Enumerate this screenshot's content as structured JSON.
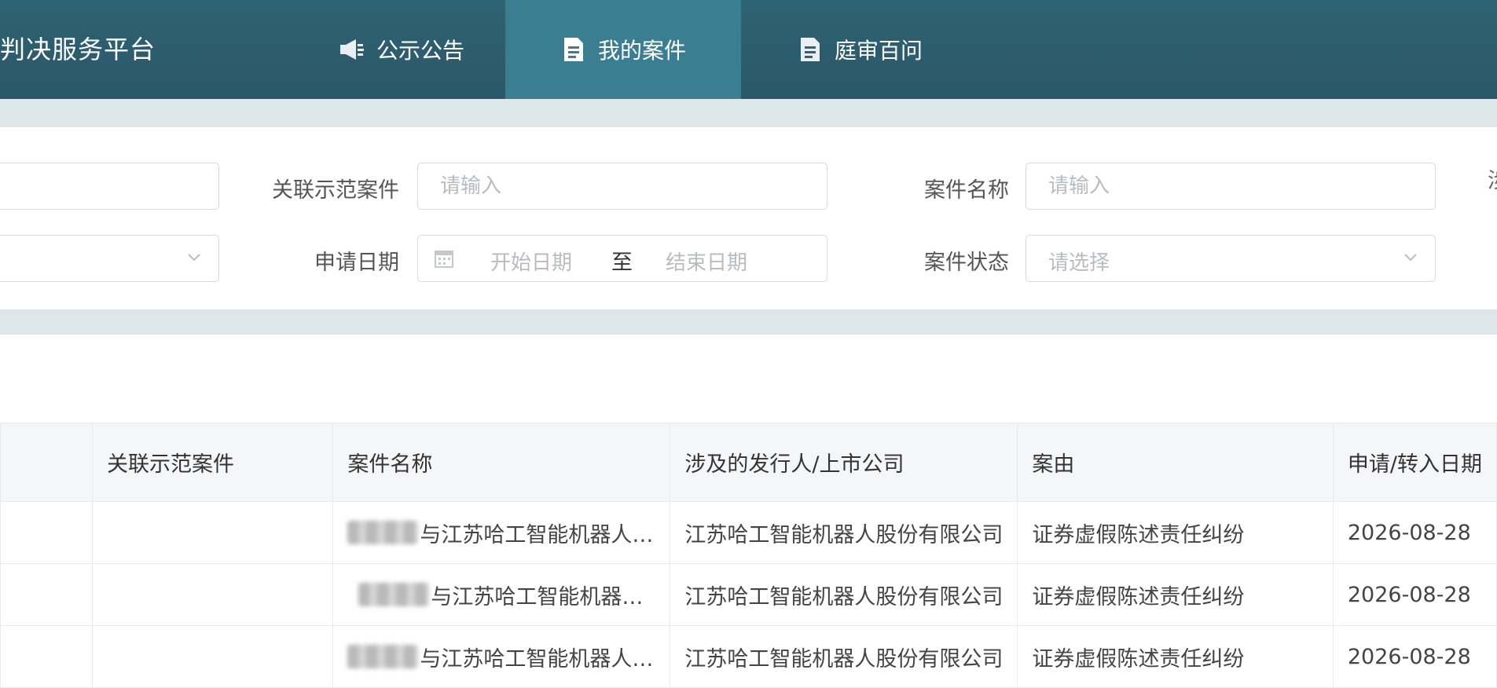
{
  "header": {
    "brand": "判决服务平台",
    "nav": [
      {
        "label": "公示公告",
        "icon": "megaphone-icon"
      },
      {
        "label": "我的案件",
        "icon": "document-icon",
        "active": true
      },
      {
        "label": "庭审百问",
        "icon": "document-icon"
      }
    ]
  },
  "filters": {
    "related_case": {
      "label": "关联示范案件",
      "placeholder": "请输入"
    },
    "case_name": {
      "label": "案件名称",
      "placeholder": "请输入"
    },
    "apply_date": {
      "label": "申请日期",
      "start_placeholder": "开始日期",
      "separator": "至",
      "end_placeholder": "结束日期"
    },
    "case_status": {
      "label": "案件状态",
      "placeholder": "请选择"
    },
    "cut_off_label": "涉"
  },
  "table": {
    "headers": [
      "",
      "关联示范案件",
      "案件名称",
      "涉及的发行人/上市公司",
      "案由",
      "申请/转入日期"
    ],
    "rows": [
      {
        "col1": "",
        "related": "",
        "case_name": "与江苏哈工智能机器人股份有限公司",
        "issuer": "江苏哈工智能机器人股份有限公司",
        "cause": "证券虚假陈述责任纠纷",
        "date": "2026-08-28"
      },
      {
        "col1": "",
        "related": "",
        "case_name": "与江苏哈工智能机器人股份有限公司",
        "issuer": "江苏哈工智能机器人股份有限公司",
        "cause": "证券虚假陈述责任纠纷",
        "date": "2026-08-28"
      },
      {
        "col1": "",
        "related": "",
        "case_name": "与江苏哈工智能机器人股份有限公司",
        "issuer": "江苏哈工智能机器人股份有限公司",
        "cause": "证券虚假陈述责任纠纷",
        "date": "2026-08-28"
      }
    ]
  },
  "colors": {
    "header_bg": "#2f6274",
    "active_tab": "#3b7e91",
    "band": "#dde6e8"
  }
}
